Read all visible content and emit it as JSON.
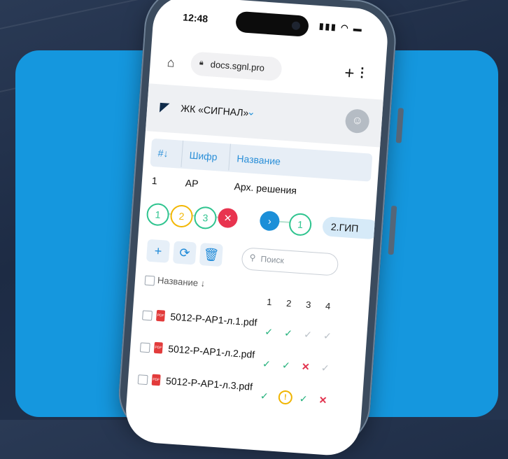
{
  "status": {
    "time": "12:48",
    "icons": "▮▮▮ ◠ ▬"
  },
  "browser": {
    "url": "docs.sgnl.pro",
    "home_icon": "home-icon",
    "add_icon": "plus-icon",
    "menu_icon": "more-vert-icon"
  },
  "project": {
    "name": "ЖК «СИГНАЛ»"
  },
  "table": {
    "headers": {
      "num": "#↓",
      "code": "Шифр",
      "title": "Название"
    },
    "row": {
      "num": "1",
      "code": "АР",
      "title": "Арх. решения"
    }
  },
  "stages": {
    "left": [
      {
        "label": "1",
        "color": "#2fc48f"
      },
      {
        "label": "2",
        "color": "#f2b705"
      },
      {
        "label": "3",
        "color": "#2fc48f"
      }
    ],
    "reject_color": "#e8344f",
    "next_color": "#1c8fd8",
    "right": [
      {
        "label": "1",
        "color": "#2fc48f"
      }
    ],
    "gip_label": "2.ГИП"
  },
  "search": {
    "placeholder": "Поиск"
  },
  "list": {
    "header": "Название ↓",
    "columns": [
      "1",
      "2",
      "3",
      "4"
    ],
    "files": [
      {
        "name": "5012-Р-АР1-л.1.pdf",
        "statuses": [
          "ok",
          "ok",
          "pending",
          "pending"
        ]
      },
      {
        "name": "5012-Р-АР1-л.2.pdf",
        "statuses": [
          "ok",
          "ok",
          "rejected",
          "pending"
        ]
      },
      {
        "name": "5012-Р-АР1-л.3.pdf",
        "statuses": [
          "ok",
          "warning",
          "ok",
          "rejected"
        ]
      }
    ]
  },
  "colors": {
    "accent": "#1597de",
    "ok": "#21b07a",
    "rejected": "#e2344f",
    "warning": "#f0b400"
  }
}
